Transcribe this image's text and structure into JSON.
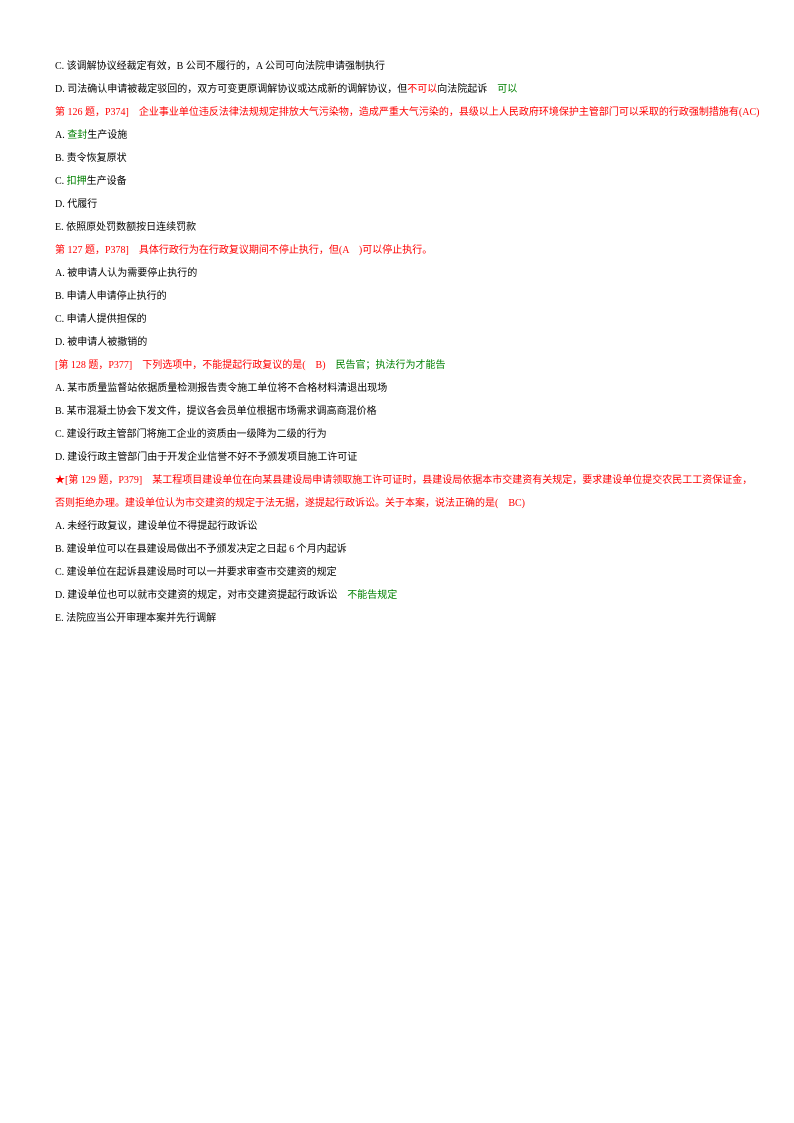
{
  "lines": [
    {
      "parts": [
        {
          "text": "C. 该调解协议经裁定有效，B 公司不履行的，A 公司可向法院申请强制执行",
          "cls": "black"
        }
      ]
    },
    {
      "parts": [
        {
          "text": "D. 司法确认申请被裁定驳回的，双方可变更原调解协议或达成新的调解协议，但",
          "cls": "black"
        },
        {
          "text": "不可以",
          "cls": "red"
        },
        {
          "text": "向法院起诉　",
          "cls": "black"
        },
        {
          "text": "可以",
          "cls": "green"
        }
      ]
    },
    {
      "parts": [
        {
          "text": "第 126 题，P374]　企业事业单位违反法律法规规定排放大气污染物，造成严重大气污染的，县级以上人民政府环境保护主管部门可以采取的行政强制措施有(AC)",
          "cls": "red"
        }
      ]
    },
    {
      "parts": [
        {
          "text": "A. ",
          "cls": "black"
        },
        {
          "text": "查封",
          "cls": "green"
        },
        {
          "text": "生产设施",
          "cls": "black"
        }
      ]
    },
    {
      "parts": [
        {
          "text": "B. 责令恢复原状",
          "cls": "black"
        }
      ]
    },
    {
      "parts": [
        {
          "text": "C. ",
          "cls": "black"
        },
        {
          "text": "扣押",
          "cls": "green"
        },
        {
          "text": "生产设备",
          "cls": "black"
        }
      ]
    },
    {
      "parts": [
        {
          "text": "D. 代履行",
          "cls": "black"
        }
      ]
    },
    {
      "parts": [
        {
          "text": "E. 依照原处罚数额按日连续罚款",
          "cls": "black"
        }
      ]
    },
    {
      "parts": [
        {
          "text": "第 127 题，P378]　具体行政行为在行政复议期间不停止执行，但(A　)可以停止执行。",
          "cls": "red"
        }
      ]
    },
    {
      "parts": [
        {
          "text": "A. 被申请人认为需要停止执行的",
          "cls": "black"
        }
      ]
    },
    {
      "parts": [
        {
          "text": "B. 申请人申请停止执行的",
          "cls": "black"
        }
      ]
    },
    {
      "parts": [
        {
          "text": "C. 申请人提供担保的",
          "cls": "black"
        }
      ]
    },
    {
      "parts": [
        {
          "text": "D. 被申请人被撤销的",
          "cls": "black"
        }
      ]
    },
    {
      "parts": [
        {
          "text": "[第 128 题，P377]　下列选项中，不能提起行政复议的是(　B)　",
          "cls": "red"
        },
        {
          "text": "民告官；执法行为才能告",
          "cls": "green"
        }
      ]
    },
    {
      "parts": [
        {
          "text": "A. 某市质量监督站依据质量检测报告责令施工单位将不合格材料清退出现场",
          "cls": "black"
        }
      ]
    },
    {
      "parts": [
        {
          "text": "B. 某市混凝土协会下发文件，提议各会员单位根据市场需求调高商混价格",
          "cls": "black"
        }
      ]
    },
    {
      "parts": [
        {
          "text": "C. 建设行政主管部门将施工企业的资质由一级降为二级的行为",
          "cls": "black"
        }
      ]
    },
    {
      "parts": [
        {
          "text": "D. 建设行政主管部门由于开发企业信誉不好不予颁发项目施工许可证",
          "cls": "black"
        }
      ]
    },
    {
      "parts": [
        {
          "text": "★[第 129 题，P379]　某工程项目建设单位在向某县建设局申请领取施工许可证时，县建设局依据本市交建资有关规定，要求建设单位提交农民工工资保证金，",
          "cls": "red"
        }
      ]
    },
    {
      "parts": [
        {
          "text": "否则拒绝办理。建设单位认为市交建资的规定于法无据，遂提起行政诉讼。关于本案，说法正确的是(　BC)",
          "cls": "red"
        }
      ]
    },
    {
      "parts": [
        {
          "text": "A. 未经行政复议，建设单位不得提起行政诉讼",
          "cls": "black"
        }
      ]
    },
    {
      "parts": [
        {
          "text": "B. 建设单位可以在县建设局做出不予颁发决定之日起 6 个月内起诉",
          "cls": "black"
        }
      ]
    },
    {
      "parts": [
        {
          "text": "C. 建设单位在起诉县建设局时可以一并要求审查市交建资的规定",
          "cls": "black"
        }
      ]
    },
    {
      "parts": [
        {
          "text": "D. 建设单位也可以就市交建资的规定，对市交建资提起行政诉讼　",
          "cls": "black"
        },
        {
          "text": "不能告规定",
          "cls": "green"
        }
      ]
    },
    {
      "parts": [
        {
          "text": "E. 法院应当公开审理本案并先行调解",
          "cls": "black"
        }
      ]
    }
  ]
}
